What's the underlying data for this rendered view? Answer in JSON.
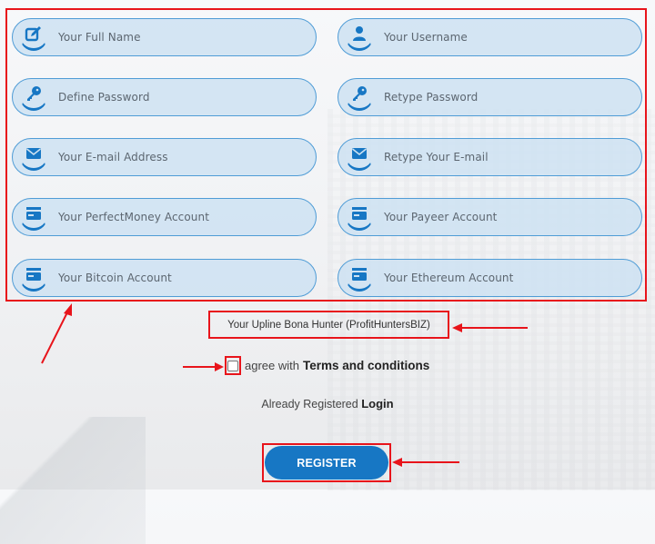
{
  "form": {
    "fields": [
      {
        "id": "full-name",
        "placeholder": "Your Full Name",
        "icon": "edit-icon"
      },
      {
        "id": "username",
        "placeholder": "Your Username",
        "icon": "user-icon"
      },
      {
        "id": "password",
        "placeholder": "Define Password",
        "icon": "key-icon"
      },
      {
        "id": "password-confirm",
        "placeholder": "Retype Password",
        "icon": "key-icon"
      },
      {
        "id": "email",
        "placeholder": "Your E-mail Address",
        "icon": "envelope-icon"
      },
      {
        "id": "email-confirm",
        "placeholder": "Retype Your E-mail",
        "icon": "envelope-icon"
      },
      {
        "id": "perfectmoney",
        "placeholder": "Your PerfectMoney Account",
        "icon": "credit-card-icon"
      },
      {
        "id": "payeer",
        "placeholder": "Your Payeer Account",
        "icon": "credit-card-icon"
      },
      {
        "id": "bitcoin",
        "placeholder": "Your Bitcoin Account",
        "icon": "credit-card-icon"
      },
      {
        "id": "ethereum",
        "placeholder": "Your Ethereum Account",
        "icon": "credit-card-icon"
      }
    ],
    "upline_text": "Your Upline Bona Hunter (ProfitHuntersBIZ)",
    "agree_prefix": "agree with",
    "agree_link": "Terms and conditions",
    "agree_checked": false,
    "login_prefix": "Already Registered",
    "login_link": "Login",
    "register_label": "REGISTER"
  },
  "colors": {
    "accent": "#1777c4",
    "annotation": "#e8141b",
    "field_bg": "#cee2f2",
    "field_border": "#4f9cd6"
  }
}
